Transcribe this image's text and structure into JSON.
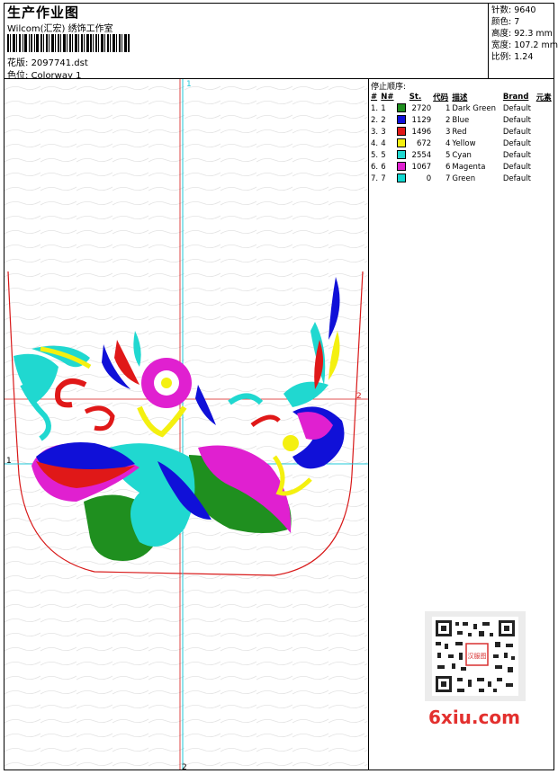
{
  "header": {
    "title": "生产作业图",
    "studio": "Wilcom(汇宏) 绣饰工作室",
    "pattern_label": "花版:",
    "pattern_value": "2097741.dst",
    "colorway_label": "色位:",
    "colorway_value": "Colorway 1"
  },
  "stats": {
    "stitches_label": "针数:",
    "stitches": "9640",
    "colors_label": "颜色:",
    "colors": "7",
    "height_label": "高度:",
    "height": "92.3 mm",
    "width_label": "宽度:",
    "width": "107.2 mm",
    "ratio_label": "比例:",
    "ratio": "1.24"
  },
  "stop_sequence": {
    "title": "停止顺序:",
    "columns": [
      "#",
      "N#",
      "St.",
      "代码",
      "描述",
      "Brand",
      "元素"
    ],
    "rows": [
      {
        "idx": "1.",
        "n": "1",
        "color": "#1f8f1f",
        "st": "2720",
        "code": "1",
        "desc": "Dark Green",
        "brand": "Default"
      },
      {
        "idx": "2.",
        "n": "2",
        "color": "#1010d8",
        "st": "1129",
        "code": "2",
        "desc": "Blue",
        "brand": "Default"
      },
      {
        "idx": "3.",
        "n": "3",
        "color": "#e01818",
        "st": "1496",
        "code": "3",
        "desc": "Red",
        "brand": "Default"
      },
      {
        "idx": "4.",
        "n": "4",
        "color": "#f4f010",
        "st": "672",
        "code": "4",
        "desc": "Yellow",
        "brand": "Default"
      },
      {
        "idx": "5.",
        "n": "5",
        "color": "#20d8d0",
        "st": "2554",
        "code": "5",
        "desc": "Cyan",
        "brand": "Default"
      },
      {
        "idx": "6.",
        "n": "6",
        "color": "#e020d0",
        "st": "1067",
        "code": "6",
        "desc": "Magenta",
        "brand": "Default"
      },
      {
        "idx": "7.",
        "n": "7",
        "color": "#10d8d0",
        "st": "0",
        "code": "7",
        "desc": "Green",
        "brand": "Default"
      }
    ]
  },
  "canvas": {
    "guide_v_top": "1",
    "guide_v_bottom": "2",
    "guide_h_left": "1",
    "guide_h_right": "2",
    "outline_color": "#d81818",
    "guide_cyan": "#20c8d8",
    "guide_red": "#d81818"
  },
  "watermark": {
    "text": "6xiu.com",
    "stamp": "汉服图"
  }
}
